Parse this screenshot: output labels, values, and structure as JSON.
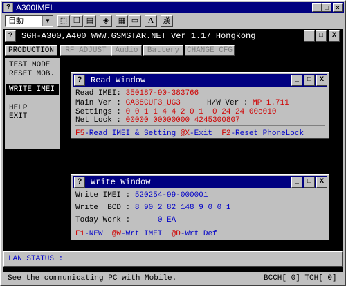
{
  "window": {
    "title": "A300IMEI"
  },
  "toolbar": {
    "font_select": "自動",
    "tool_a": "A",
    "tool_han": "漢"
  },
  "dos": {
    "heading": "SGH-A300,A400 WWW.GSMSTAR.NET Ver 1.17 Hongkong",
    "menu": [
      "PRODUCTION",
      "RF ADJUST",
      "Audio",
      "Battery",
      "CHANGE CFG"
    ],
    "side": {
      "test_mode": "TEST  MODE",
      "reset_mob": "RESET MOB.",
      "write_imei": "WRITE IMEI",
      "help": "HELP",
      "exit": "EXIT"
    }
  },
  "read_window": {
    "title": "Read Window",
    "read_imei_label": "Read IMEI: ",
    "read_imei_value": "350187-90-383766",
    "main_ver_label": "Main Ver : ",
    "main_ver_value": "GA38CUF3_UG3",
    "hw_ver_label": "H/W Ver : ",
    "hw_ver_value": "MP 1.711",
    "settings_label": "Settings : ",
    "settings_value": "0 0 1 1 4 4 2 0 1  0 24 24 00c010",
    "net_lock_label": "Net Lock : ",
    "net_lock_value": "00000 00000000 4245300807",
    "f5": "F5",
    "f5_text": "-Read IMEI & Setting ",
    "x_key": "@X",
    "x_text": "-Exit  ",
    "f2": "F2",
    "f2_text": "-Reset PhoneLock"
  },
  "write_window": {
    "title": "Write Window",
    "write_imei_label": "Write IMEI : ",
    "write_imei_value": "520254-99-000001",
    "write_bcd_label": "Write  BCD : ",
    "write_bcd_value": "8 90 2 82 148 9 0 0 1",
    "today_work_label": "Today Work :      ",
    "today_work_value": "0 EA",
    "f1": "F1",
    "f1_text": "-NEW  ",
    "w_key": "@W",
    "w_text": "-Wrt IMEI  ",
    "d_key": "@D",
    "d_text": "-Wrt Def"
  },
  "lan_status": "LAN STATUS :",
  "status": {
    "message": "See the communicating PC with Mobile.",
    "bcch": "BCCH[ 0] TCH[ 0]"
  },
  "colors": {
    "title_bar": "#000080",
    "value_red": "#d00000",
    "value_blue": "#0000c8",
    "background": "#c0c0c0"
  }
}
